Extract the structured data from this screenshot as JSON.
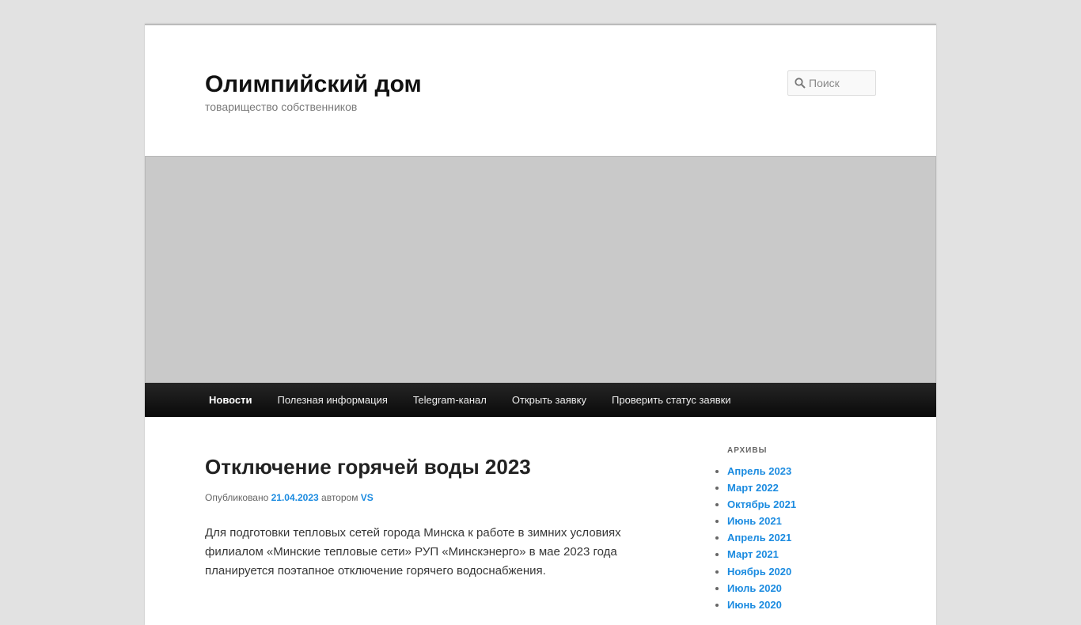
{
  "site": {
    "title": "Олимпийский дом",
    "description": "товарищество собственников"
  },
  "search": {
    "placeholder": "Поиск"
  },
  "nav": {
    "items": [
      {
        "label": "Новости",
        "active": true
      },
      {
        "label": "Полезная информация"
      },
      {
        "label": "Telegram-канал"
      },
      {
        "label": "Открыть заявку"
      },
      {
        "label": "Проверить статус заявки"
      }
    ]
  },
  "post": {
    "title": "Отключение горячей воды 2023",
    "meta_prefix": "Опубликовано",
    "date": "21.04.2023",
    "by": "автором",
    "author": "VS",
    "paragraph": "Для подготовки тепловых сетей города Минска к работе в зимних условиях филиалом «Минские тепловые сети» РУП «Минскэнерго» в мае 2023 года планируется поэтапное отключение горячего водоснабжения."
  },
  "sidebar": {
    "archives_title": "Архивы",
    "archives": [
      "Апрель 2023",
      "Март 2022",
      "Октябрь 2021",
      "Июнь 2021",
      "Апрель 2021",
      "Март 2021",
      "Ноябрь 2020",
      "Июль 2020",
      "Июнь 2020"
    ]
  },
  "colors": {
    "link": "#1b8be0",
    "nav_bg": "#111111",
    "page_bg": "#e2e2e2"
  }
}
